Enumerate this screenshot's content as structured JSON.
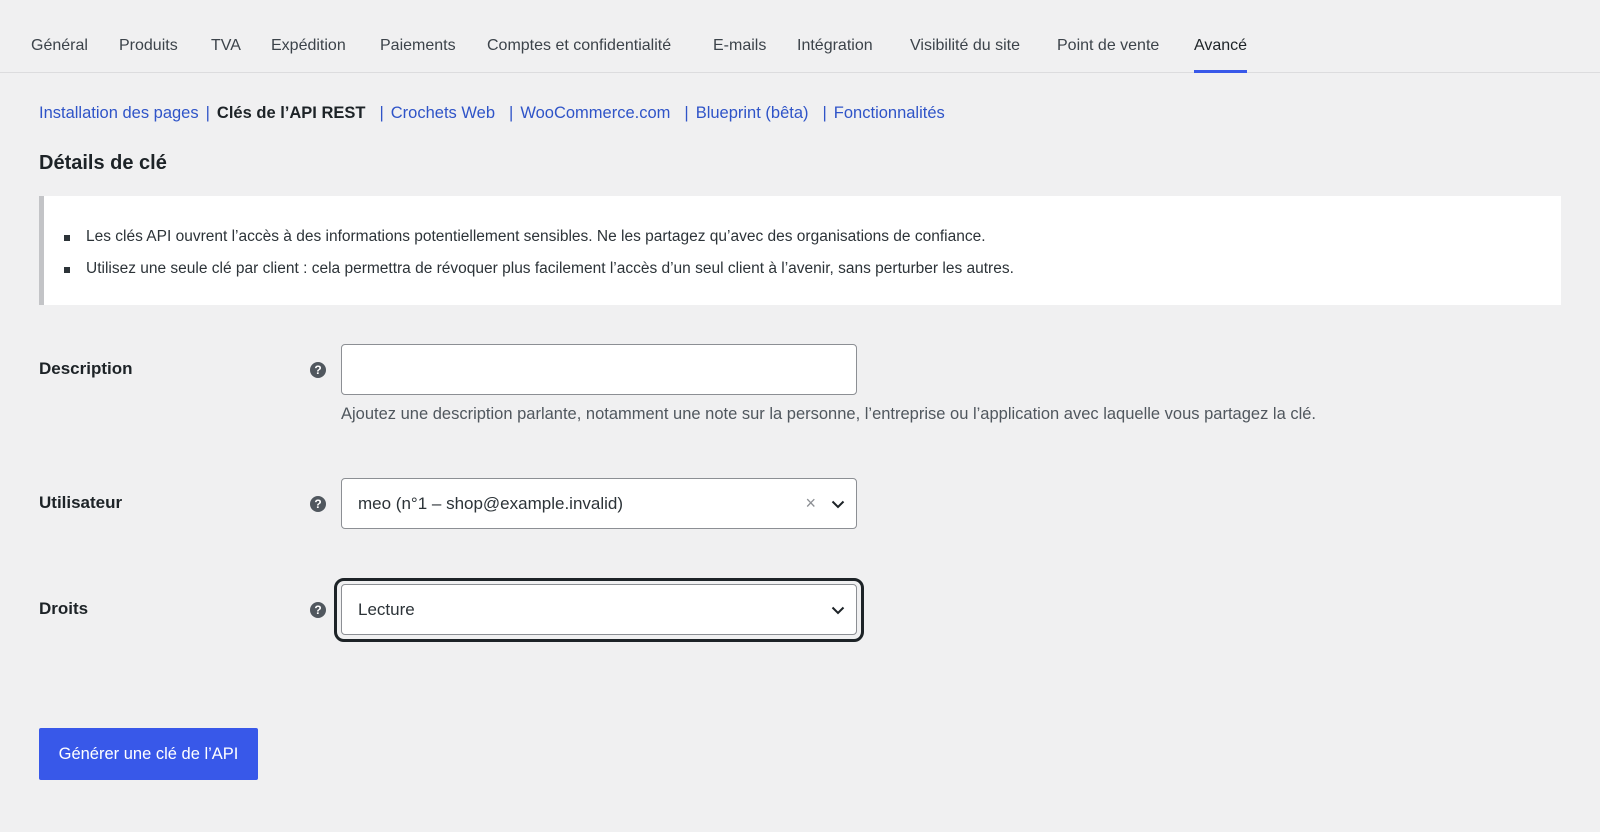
{
  "tabs": [
    {
      "label": "Général"
    },
    {
      "label": "Produits"
    },
    {
      "label": "TVA"
    },
    {
      "label": "Expédition"
    },
    {
      "label": "Paiements"
    },
    {
      "label": "Comptes et confidentialité"
    },
    {
      "label": "E-mails"
    },
    {
      "label": "Intégration"
    },
    {
      "label": "Visibilité du site"
    },
    {
      "label": "Point de vente"
    },
    {
      "label": "Avancé",
      "active": true
    }
  ],
  "subnav": {
    "items": [
      {
        "label": "Installation des pages"
      },
      {
        "label": "Clés de l’API REST",
        "current": true
      },
      {
        "label": "Crochets Web"
      },
      {
        "label": "WooCommerce.com"
      },
      {
        "label": "Blueprint (bêta)"
      },
      {
        "label": "Fonctionnalités"
      }
    ],
    "separator": "|"
  },
  "section": {
    "title": "Détails de clé"
  },
  "notice": {
    "items": [
      "Les clés API ouvrent l’accès à des informations potentiellement sensibles. Ne les partagez qu’avec des organisations de confiance.",
      "Utilisez une seule clé par client : cela permettra de révoquer plus facilement l’accès d’un seul client à l’avenir, sans perturber les autres."
    ]
  },
  "form": {
    "help_glyph": "?",
    "description": {
      "label": "Description",
      "value": "",
      "help_text": "Ajoutez une description parlante, notamment une note sur la personne, l’entreprise ou l’application avec laquelle vous partagez la clé."
    },
    "user": {
      "label": "Utilisateur",
      "selected": "meo (n°1 – shop@example.invalid)",
      "clear_glyph": "×"
    },
    "permissions": {
      "label": "Droits",
      "selected": "Lecture"
    },
    "submit_label": "Générer une clé de l’API"
  },
  "colors": {
    "accent": "#3858e9",
    "link": "#2f54c8",
    "background": "#f0f0f1"
  }
}
